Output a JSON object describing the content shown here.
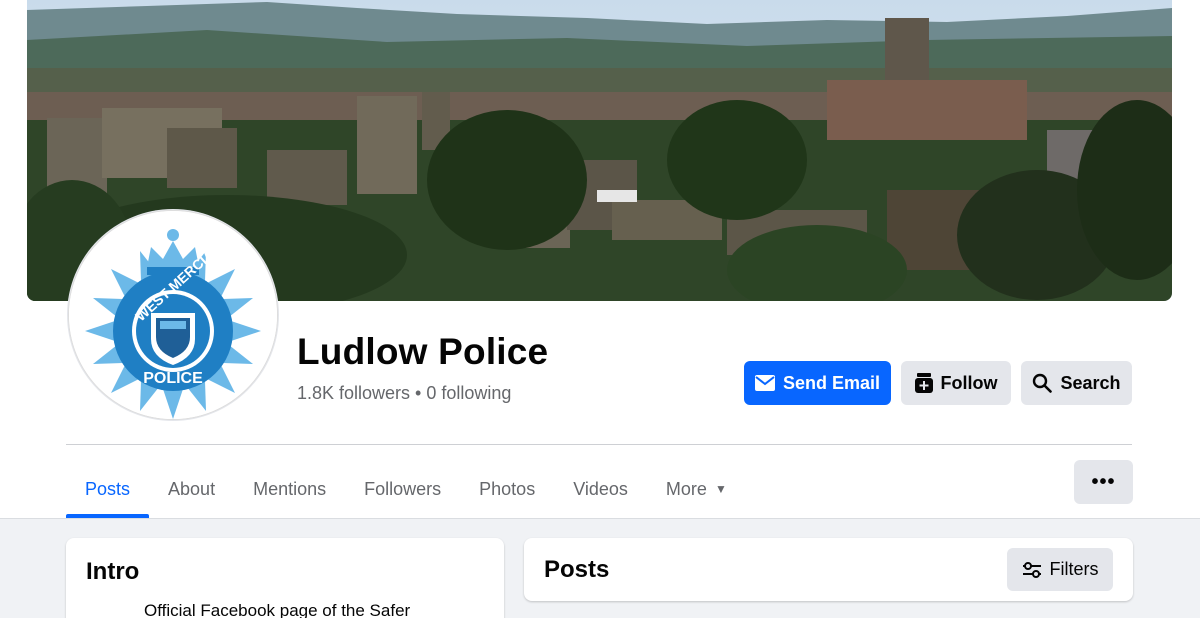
{
  "page": {
    "name": "Ludlow Police",
    "followers_text": "1.8K followers • 0 following"
  },
  "logo": {
    "ring_text_top": "WEST MERCIA",
    "ring_text_bottom": "POLICE"
  },
  "actions": {
    "send_email": "Send Email",
    "follow": "Follow",
    "search": "Search",
    "more": "•••"
  },
  "tabs": [
    {
      "label": "Posts",
      "active": true
    },
    {
      "label": "About"
    },
    {
      "label": "Mentions"
    },
    {
      "label": "Followers"
    },
    {
      "label": "Photos"
    },
    {
      "label": "Videos"
    },
    {
      "label": "More"
    }
  ],
  "intro": {
    "title": "Intro",
    "text": "Official Facebook page of the Safer"
  },
  "posts": {
    "title": "Posts",
    "filters_label": "Filters"
  },
  "colors": {
    "accent": "#0866ff",
    "button_grey": "#e4e6eb",
    "text_secondary": "#65676b",
    "background": "#f0f2f5"
  }
}
